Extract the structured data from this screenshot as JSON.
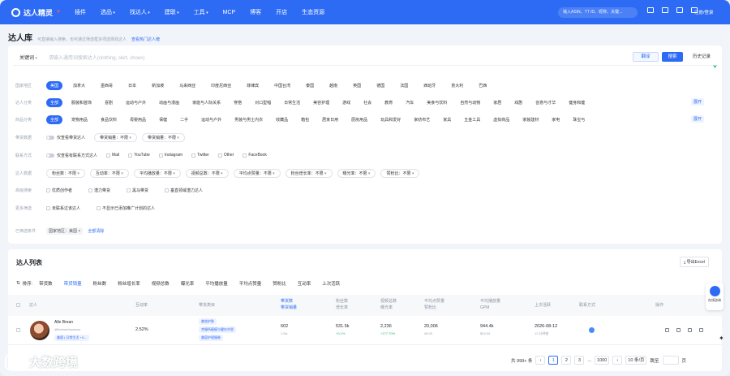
{
  "nav": {
    "brand": "达人精灵",
    "items": [
      "插件",
      "选品",
      "找达人",
      "建联",
      "工具",
      "MCP",
      "博客",
      "开店",
      "生态资源"
    ],
    "search_placeholder": "输入ASIN、TT ID、昵称、关键...",
    "login": "注册/登录"
  },
  "page": {
    "title": "达人库",
    "subtitle": "可直接输入搜索，也可通过筛选框多项选择找达人",
    "hot_link": "查看热门达人榜"
  },
  "search": {
    "keyword_label": "关键词",
    "placeholder": "请输入通用词搜索达人(clothing, skirt, shoes)",
    "translate": "翻译",
    "search": "搜索",
    "history": "历史记录"
  },
  "filters": {
    "country": {
      "label": "国家地区",
      "options": [
        "美国",
        "加拿大",
        "墨西哥",
        "日本",
        "新加坡",
        "马来西亚",
        "印度尼西亚",
        "菲律宾",
        "中国台湾",
        "泰国",
        "越南",
        "英国",
        "德国",
        "法国",
        "西班牙",
        "意大利",
        "巴西"
      ]
    },
    "category": {
      "label": "达人分类",
      "options": [
        "全部",
        "服装和首饰",
        "喜剧",
        "运动与户外",
        "动画与漫画",
        "家庭与人际关系",
        "穿搭",
        "对口型唱",
        "日常生活",
        "美容护理",
        "游戏",
        "社会",
        "教育",
        "汽车",
        "美食与饮料",
        "自然与动物",
        "家居",
        "戏剧",
        "创意与才华",
        "健身和健"
      ],
      "more": "展开"
    },
    "product": {
      "label": "商品分类",
      "options": [
        "全部",
        "宠物用品",
        "食品饮料",
        "母婴用品",
        "保健",
        "二手",
        "运动与户外",
        "男装与男士内衣",
        "收藏品",
        "箱包",
        "居家日用",
        "厨房用品",
        "玩具和爱好",
        "家纺布艺",
        "家具",
        "五金工具",
        "虚拟商品",
        "家装建材",
        "家电",
        "珠宝与"
      ],
      "more": "展开"
    },
    "sales": {
      "label": "带货数据",
      "toggle": "仅查看带货达人",
      "selects": [
        "带货销量：不限",
        "带货销量：不限"
      ]
    },
    "contact": {
      "label": "联系方式",
      "toggle": "仅查看有联系方式达人",
      "options": [
        "Mail",
        "YouTube",
        "Instagram",
        "Twitter",
        "Other",
        "FaceBook"
      ]
    },
    "data": {
      "label": "达人数据",
      "selects": [
        "粉丝数：不限",
        "互动率：不限",
        "平均播放量：不限",
        "视频总数：不限",
        "平均点赞量：不限",
        "粉丝增长率：不限",
        "曝光率：不限",
        "赞粉比：不限"
      ]
    },
    "advanced": {
      "label": "高级搜索",
      "options": [
        "优质创作者",
        "潜力带货",
        "黑马带货",
        "垂直领域潜力达人"
      ]
    },
    "more_filter": {
      "label": "更多筛选",
      "options": [
        "未联系过该达人",
        "不显示已添加推广计划的达人"
      ]
    },
    "applied": {
      "label": "已筛选条件",
      "tag": "国家地区：美国",
      "clear": "全部清除"
    }
  },
  "list": {
    "title": "达人列表",
    "export": "导出Excel",
    "sort_label": "排序:",
    "sort": [
      "带货数",
      "带货销量",
      "粉丝数",
      "粉丝增长率",
      "视频总数",
      "曝光率",
      "平均播放量",
      "平均点赞量",
      "赞粉比",
      "互动率",
      "上次活跃"
    ],
    "columns": [
      "达人",
      "互动率",
      "带货类目",
      "带货数",
      "带货销量",
      "粉丝数",
      "增长率",
      "视频总数",
      "曝光率",
      "平均点赞量",
      "赞粉比",
      "平均播放量",
      "GPM",
      "上次活跃",
      "联系方式",
      "操作"
    ],
    "row": {
      "name": "Alle Brean",
      "handle": "@thebarbiepawns",
      "tag": "美国 | 日常生活 +1/...",
      "engagement": "2.52%",
      "categories": [
        "美妆护肤",
        "克服所瘦瘦与健在市里",
        "美容护理服装"
      ],
      "items": "602",
      "sales": "1.5w",
      "followers": "531.5k",
      "growth": "+0.1%",
      "videos": "2,236",
      "exposure": "+177.70%",
      "likes": "20,006",
      "fan_ratio": "48.05",
      "views": "944.4k",
      "gpm": "$24.04",
      "last_active": "2026-08-12",
      "last_sub": "12 分钟前"
    },
    "pager": {
      "total": "共 999+ 条",
      "pages": [
        "1",
        "2",
        "3",
        "...",
        "1000"
      ],
      "size": "10 条/页",
      "goto": "跳至",
      "unit": "页"
    }
  },
  "float": {
    "label": "在线咨询"
  },
  "watermark": "大数跨境"
}
